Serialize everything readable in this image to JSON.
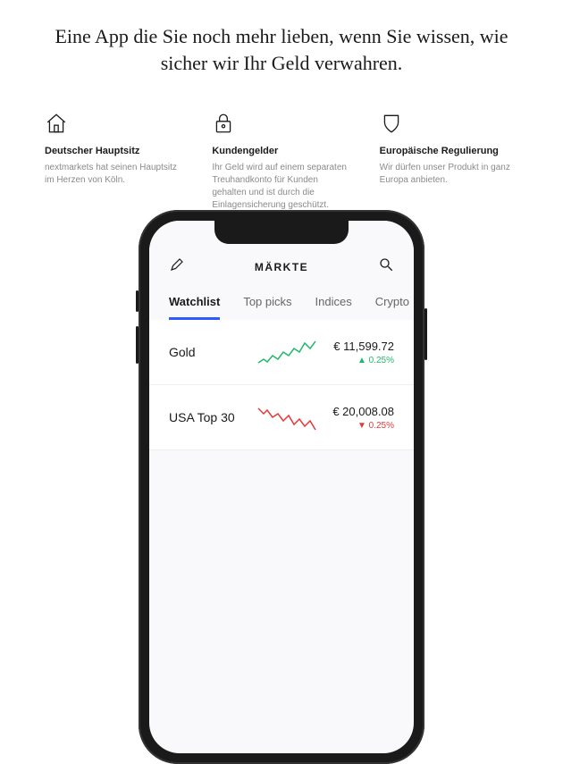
{
  "headline": "Eine App die Sie noch mehr lieben, wenn Sie wissen, wie sicher wir Ihr Geld verwahren.",
  "features": [
    {
      "icon": "house-icon",
      "title": "Deutscher Hauptsitz",
      "desc": "nextmarkets hat seinen Hauptsitz im Herzen von Köln."
    },
    {
      "icon": "lock-icon",
      "title": "Kundengelder",
      "desc": "Ihr Geld wird auf einem separaten Treuhandkonto für Kunden gehalten und ist durch die Einlagensicherung geschützt."
    },
    {
      "icon": "shield-icon",
      "title": "Europäische Regulierung",
      "desc": "Wir dürfen unser Produkt in ganz Europa anbieten."
    }
  ],
  "phone": {
    "header_title": "MÄRKTE",
    "tabs": [
      {
        "label": "Watchlist",
        "active": true
      },
      {
        "label": "Top picks",
        "active": false
      },
      {
        "label": "Indices",
        "active": false
      },
      {
        "label": "Crypto",
        "active": false
      }
    ],
    "rows": [
      {
        "name": "Gold",
        "price": "€ 11,599.72",
        "change": "0.25%",
        "direction": "up",
        "spark_color": "#1fb86b"
      },
      {
        "name": "USA Top 30",
        "price": "€ 20,008.08",
        "change": "0.25%",
        "direction": "down",
        "spark_color": "#e33939"
      }
    ]
  }
}
